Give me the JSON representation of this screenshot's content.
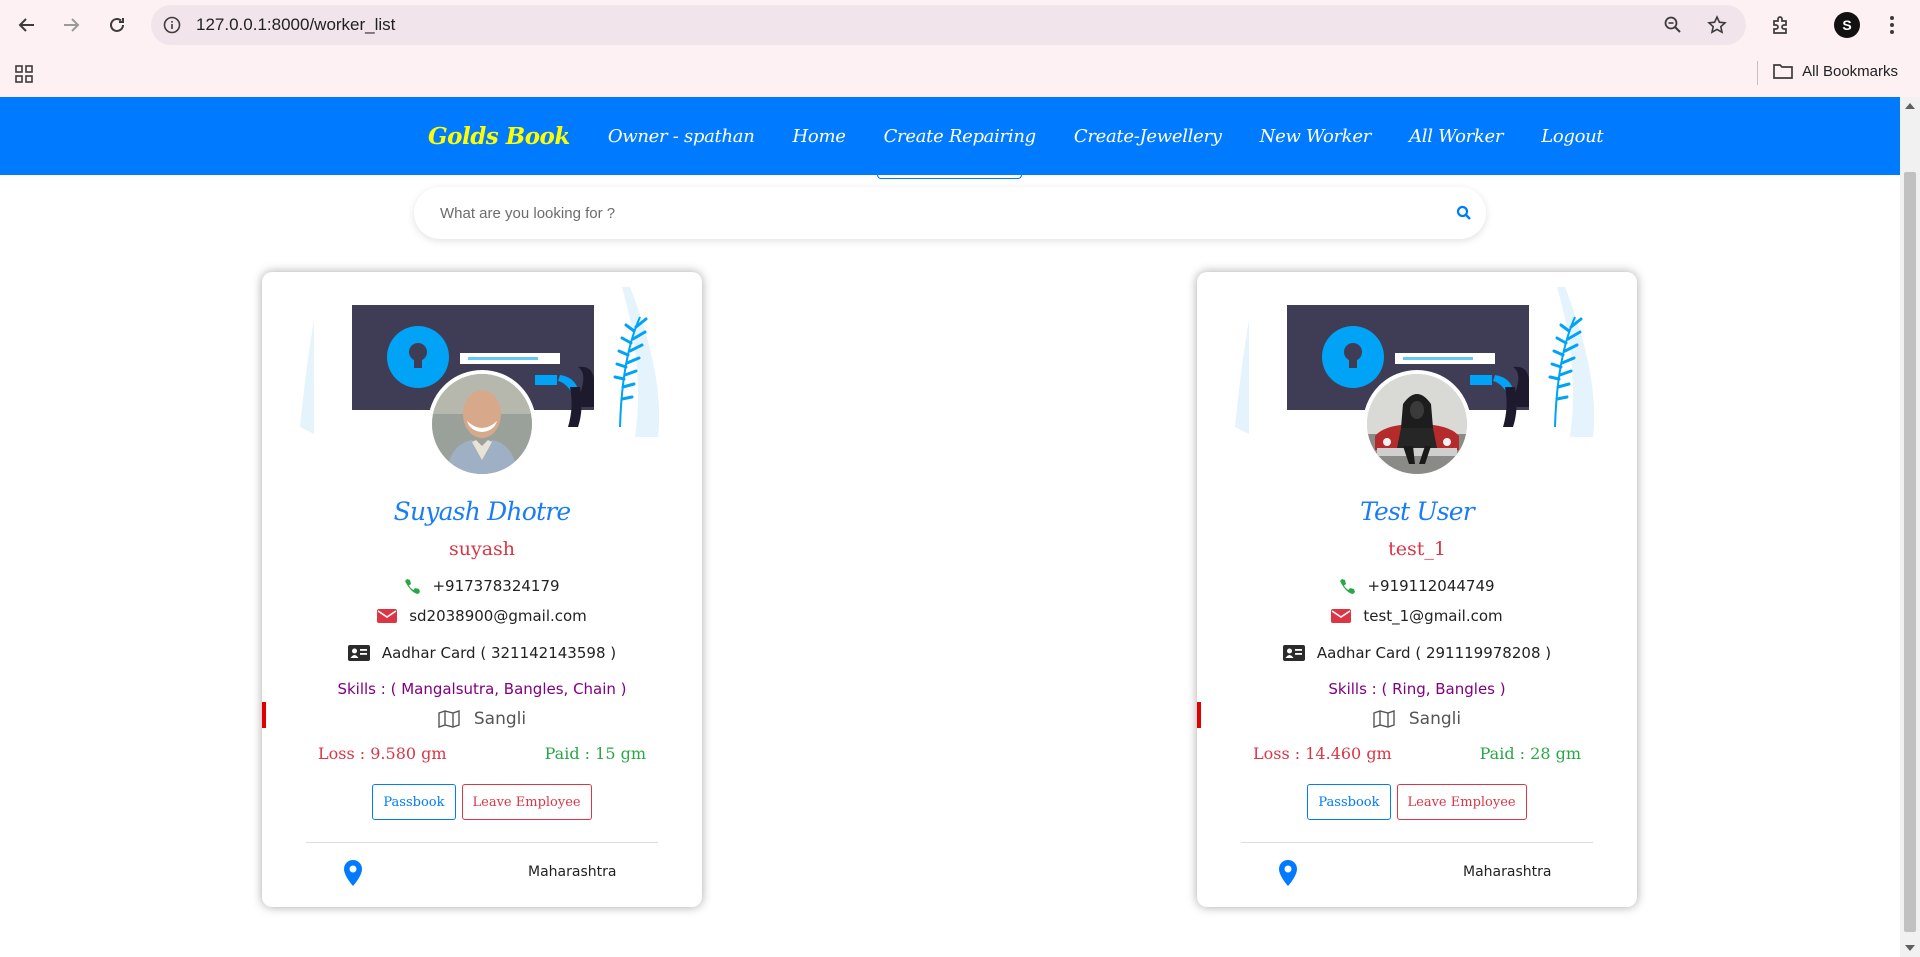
{
  "browser": {
    "url": "127.0.0.1:8000/worker_list",
    "bookmarks_label": "All Bookmarks",
    "profile_initial": "S"
  },
  "nav": {
    "brand": "Golds Book",
    "links": [
      "Owner - spathan",
      "Home",
      "Create Repairing",
      "Create-Jewellery",
      "New Worker",
      "All Worker",
      "Logout"
    ]
  },
  "search": {
    "placeholder": "What are you looking for ?"
  },
  "workers": [
    {
      "name": "Suyash Dhotre",
      "username": "suyash",
      "phone": "+917378324179",
      "email": "sd2038900@gmail.com",
      "aadhar": "Aadhar Card ( 321142143598 )",
      "skills": "Skills : ( Mangalsutra, Bangles, Chain )",
      "city": "Sangli",
      "loss": "Loss : 9.580 gm",
      "paid": "Paid : 15 gm",
      "passbook_label": "Passbook",
      "leave_label": "Leave Employee",
      "state": "Maharashtra"
    },
    {
      "name": "Test User",
      "username": "test_1",
      "phone": "+919112044749",
      "email": "test_1@gmail.com",
      "aadhar": "Aadhar Card ( 291119978208 )",
      "skills": "Skills : ( Ring, Bangles )",
      "city": "Sangli",
      "loss": "Loss : 14.460 gm",
      "paid": "Paid : 28 gm",
      "passbook_label": "Passbook",
      "leave_label": "Leave Employee",
      "state": "Maharashtra"
    }
  ],
  "colors": {
    "navbar": "#007bff",
    "brand": "#ffff00",
    "name": "#1a7df5",
    "username": "#dc3545",
    "skills": "#800080",
    "paid": "#28a745"
  }
}
